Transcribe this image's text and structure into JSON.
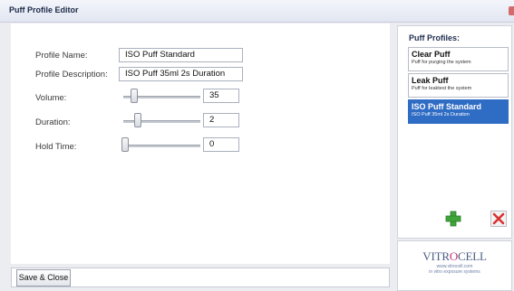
{
  "window": {
    "title": "Puff Profile Editor"
  },
  "form": {
    "profile_name_label": "Profile Name:",
    "profile_name_value": "ISO Puff Standard",
    "profile_description_label": "Profile Description:",
    "profile_description_value": "ISO Puff 35ml 2s Duration",
    "volume_label": "Volume:",
    "volume_value": "35",
    "volume_slider_fraction": 0.1,
    "duration_label": "Duration:",
    "duration_value": "2",
    "duration_slider_fraction": 0.15,
    "hold_time_label": "Hold Time:",
    "hold_time_value": "0",
    "hold_time_slider_fraction": 0.0
  },
  "profiles_panel": {
    "header": "Puff Profiles:",
    "items": [
      {
        "name": "Clear Puff",
        "description": "Puff for purging the system",
        "selected": false
      },
      {
        "name": "Leak Puff",
        "description": "Puff for leaktest the system",
        "selected": false
      },
      {
        "name": "ISO Puff Standard",
        "description": "ISO Puff 35ml 2s Duration",
        "selected": true
      }
    ]
  },
  "logo": {
    "wordmark": "VITROCELL",
    "line1": "www.vitrocell.com",
    "line2": "in vitro exposure systems"
  },
  "footer": {
    "save_close_label": "Save & Close"
  },
  "colors": {
    "selected_row": "#2f6cc4",
    "add_icon": "#3fa53b",
    "delete_icon": "#d93232",
    "logo_accent": "#c0347a"
  },
  "icons": {
    "add": "add-icon",
    "delete": "delete-icon",
    "close": "close-icon"
  }
}
